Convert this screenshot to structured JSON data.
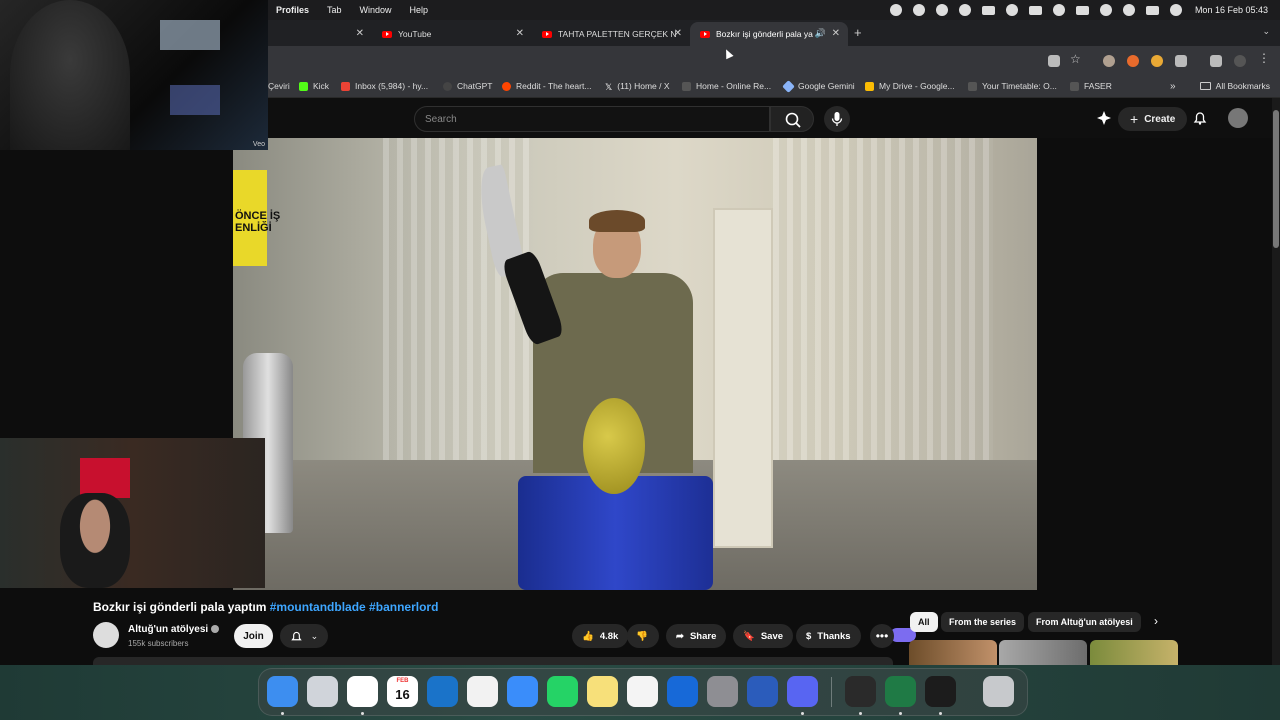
{
  "menubar": {
    "menus": [
      "Profiles",
      "Tab",
      "Window",
      "Help"
    ],
    "clock": "Mon 16 Feb  05:43"
  },
  "tabs": [
    {
      "label": ""
    },
    {
      "label": "YouTube"
    },
    {
      "label": "TAHTA PALETTEN GERÇEK N"
    },
    {
      "label": "Bozkır işi gönderli pala ya"
    }
  ],
  "bookmarks": [
    {
      "label": "Çeviri",
      "color": "#4285f4"
    },
    {
      "label": "Kick",
      "color": "#53fc18"
    },
    {
      "label": "Inbox (5,984) - hy...",
      "color": "#ea4335"
    },
    {
      "label": "ChatGPT",
      "color": "#444444"
    },
    {
      "label": "Reddit - The heart...",
      "color": "#ff4500"
    },
    {
      "label": "(11) Home / X",
      "color": "#ffffff"
    },
    {
      "label": "Home - Online Re...",
      "color": "#333333"
    },
    {
      "label": "Google Gemini",
      "color": "#8ab4f8"
    },
    {
      "label": "My Drive - Google...",
      "color": "#fbbc04"
    },
    {
      "label": "Your Timetable: O...",
      "color": "#333333"
    },
    {
      "label": "FASER",
      "color": "#333333"
    }
  ],
  "all_bookmarks": "All Bookmarks",
  "yt_header": {
    "search_placeholder": "Search",
    "create_label": "Create"
  },
  "webcam": {
    "watermark": "Veo"
  },
  "video": {
    "sign_text": "ÖNCE İŞ\nENLİĞİ"
  },
  "under_video": {
    "title_main": "Bozkır işi gönderli pala yaptım",
    "title_tags": "#mountandblade #bannerlord",
    "channel_name": "Altuğ'un atölyesi",
    "subscribers": "155k subscribers",
    "join_label": "Join",
    "likes": "4.8k",
    "share_label": "Share",
    "save_label": "Save",
    "thanks_label": "Thanks"
  },
  "chips": [
    "All",
    "From the series",
    "From Altuğ'un atölyesi"
  ],
  "dock_apps": [
    {
      "name": "Finder",
      "color": "#3d8ef0"
    },
    {
      "name": "Launchpad",
      "color": "#d0d4da"
    },
    {
      "name": "Chrome",
      "color": "#ffffff"
    },
    {
      "name": "Calendar",
      "color": "#ffffff"
    },
    {
      "name": "Outlook",
      "color": "#1a73c9"
    },
    {
      "name": "Gmail",
      "color": "#f2f2f2"
    },
    {
      "name": "Mail",
      "color": "#3a8dfa"
    },
    {
      "name": "WhatsApp",
      "color": "#25d366"
    },
    {
      "name": "Notes",
      "color": "#f7e07a"
    },
    {
      "name": "Reminders",
      "color": "#f4f4f4"
    },
    {
      "name": "Keynote",
      "color": "#1769d8"
    },
    {
      "name": "System Settings",
      "color": "#8e8e93"
    },
    {
      "name": "Word",
      "color": "#2b5cbb"
    },
    {
      "name": "Discord",
      "color": "#5865f2"
    },
    {
      "name": "OBS",
      "color": "#2a2a2a"
    },
    {
      "name": "Excel",
      "color": "#1f7a45"
    },
    {
      "name": "Activity Monitor",
      "color": "#1c1c1c"
    },
    {
      "name": "Trash",
      "color": "#c7c9cc"
    }
  ],
  "calendar_month": "FEB",
  "calendar_day": "16"
}
